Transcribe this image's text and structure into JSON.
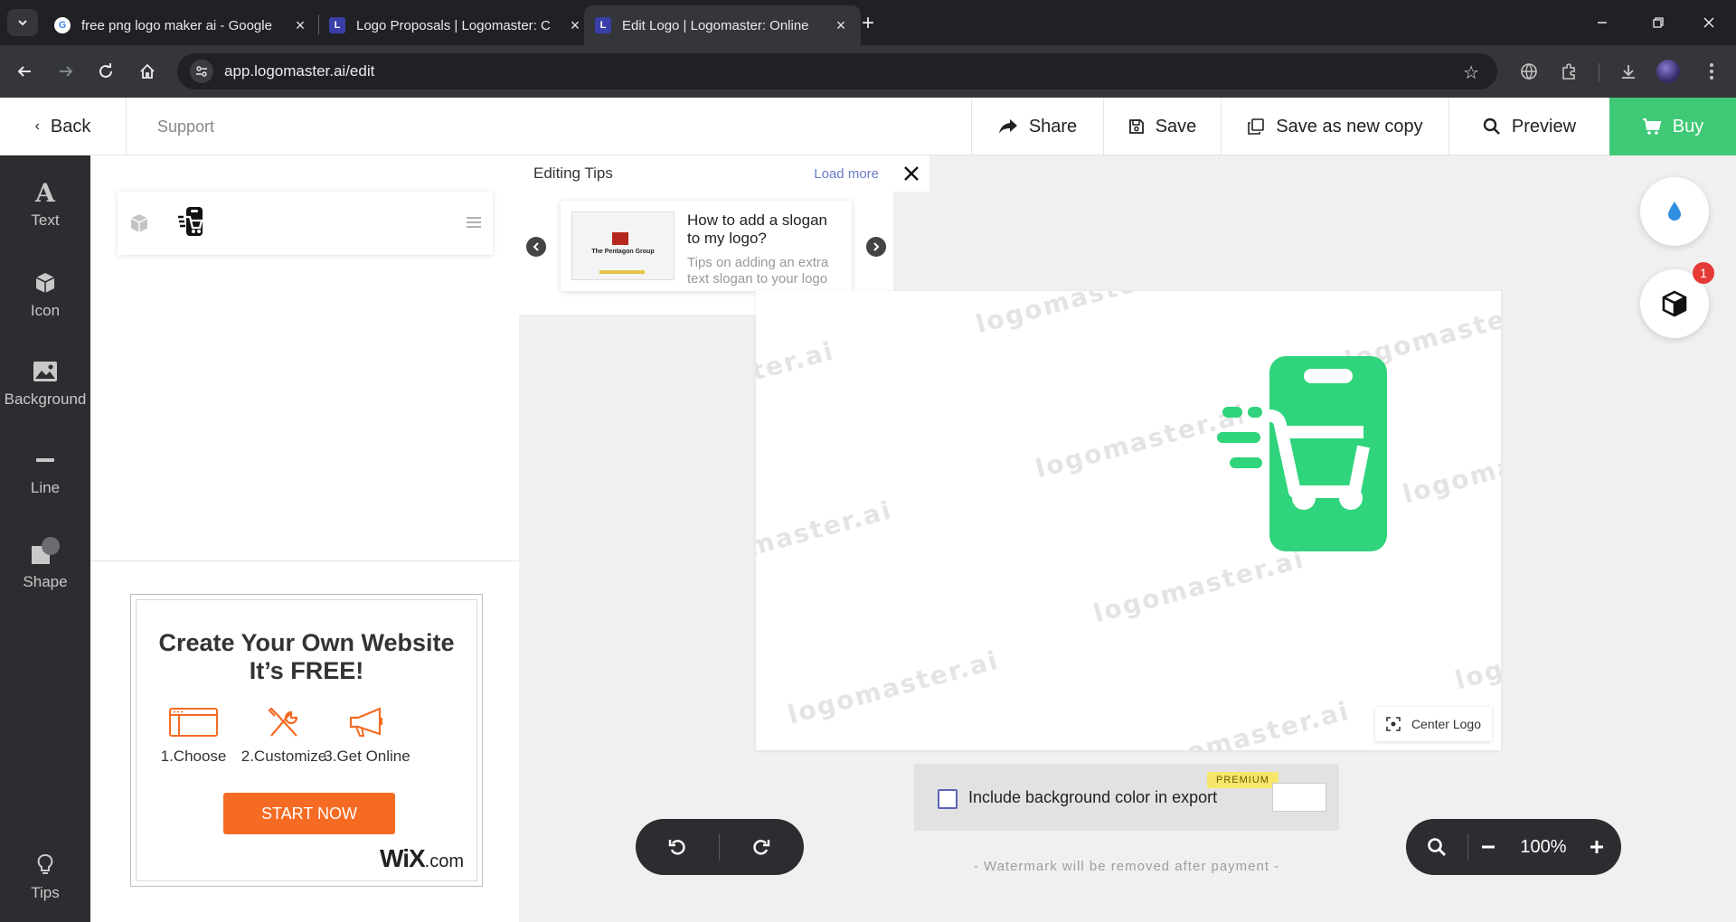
{
  "browser": {
    "tabs": [
      {
        "title": "free png logo maker ai - Google",
        "favicon": "G"
      },
      {
        "title": "Logo Proposals | Logomaster: C",
        "favicon": "L"
      },
      {
        "title": "Edit Logo | Logomaster: Online",
        "favicon": "L"
      }
    ],
    "url": "app.logomaster.ai/edit"
  },
  "header": {
    "back_label": "Back",
    "support_label": "Support",
    "share_label": "Share",
    "save_label": "Save",
    "save_copy_label": "Save as new copy",
    "preview_label": "Preview",
    "buy_label": "Buy",
    "buy_color": "#3fc977"
  },
  "tools": [
    {
      "label": "Text",
      "icon": "text-icon"
    },
    {
      "label": "Icon",
      "icon": "cube-icon"
    },
    {
      "label": "Background",
      "icon": "image-icon"
    },
    {
      "label": "Line",
      "icon": "line-icon"
    },
    {
      "label": "Shape",
      "icon": "shape-icon"
    },
    {
      "label": "Tips",
      "icon": "lightbulb-icon"
    }
  ],
  "ad": {
    "title_line1": "Create Your Own Website",
    "title_line2": "It’s FREE!",
    "steps": [
      "1.Choose",
      "2.Customize",
      "3.Get Online"
    ],
    "cta": "START NOW",
    "brand": "WiX",
    "brand_suffix": ".com",
    "accent": "#f56b23"
  },
  "tips": {
    "title": "Editing Tips",
    "load_more": "Load more",
    "card_title": "How to add a slogan to my logo?",
    "card_subtitle": "Tips on adding an extra text slogan to your logo",
    "thumb_caption": "The Pentagon Group"
  },
  "canvas": {
    "watermark": "logomaster.ai",
    "center_logo_label": "Center Logo",
    "logo_color": "#2fd47c"
  },
  "export": {
    "include_bg_label": "Include background color in export",
    "premium_label": "PREMIUM",
    "checked": false,
    "watermark_note": "- Watermark will be removed after payment -"
  },
  "zoom": {
    "level": "100%"
  },
  "floating": {
    "badge_count": "1"
  }
}
